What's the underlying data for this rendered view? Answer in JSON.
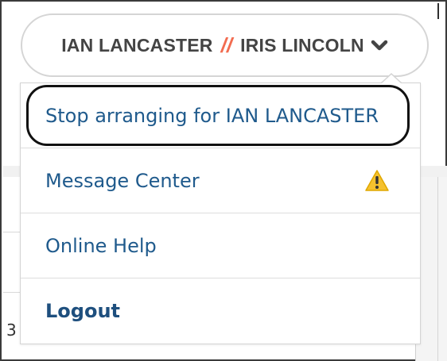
{
  "header": {
    "primary_user": "IAN LANCASTER",
    "separator": "//",
    "secondary_user": "IRIS LINCOLN",
    "dropdown_icon": "chevron-down-icon"
  },
  "menu": {
    "items": [
      {
        "label": "Stop arranging for IAN LANCASTER"
      },
      {
        "label": "Message Center",
        "icon": "warning-icon"
      },
      {
        "label": "Online Help"
      },
      {
        "label": "Logout"
      }
    ]
  },
  "background": {
    "partial_text": "3"
  },
  "colors": {
    "separator": "#f26c50",
    "link": "#1f5a8c",
    "warning": "#f5c12e"
  }
}
